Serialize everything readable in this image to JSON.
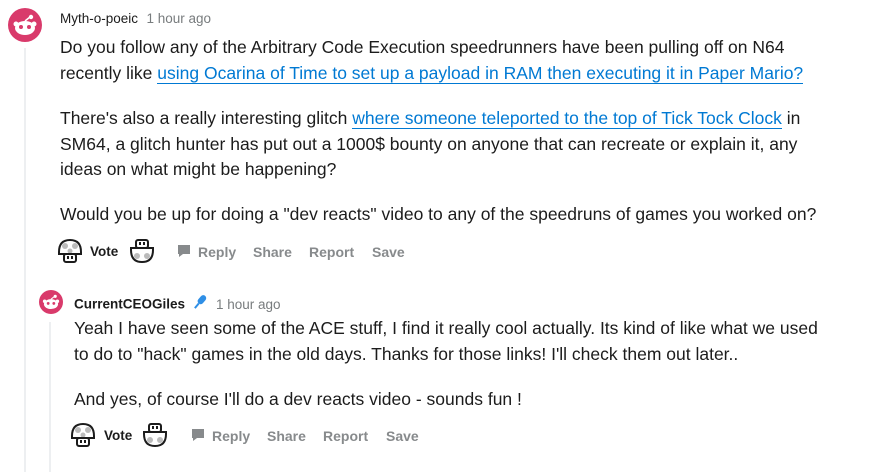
{
  "comment": {
    "author": "Myth-o-poeic",
    "time": "1 hour ago",
    "paragraphs": {
      "p1_line1": "Do you follow any of the Arbitrary Code Execution speedrunners have been pulling off on N64",
      "p1_line2_prefix": "recently like ",
      "p1_link": "using Ocarina of Time to set up a payload in RAM then executing it in Paper Mario?",
      "p2_line1_prefix": "There's also a really interesting glitch ",
      "p2_link": "where someone teleported to the top of Tick Tock Clock",
      "p2_line1_suffix": " in",
      "p2_line2": "SM64, a glitch hunter has put out a 1000$ bounty on anyone that can recreate or explain it, any",
      "p2_line3": "ideas on what might be happening?",
      "p3": "Would you be up for doing a \"dev reacts\" video to any of the speedruns of games you worked on?"
    },
    "actions": {
      "vote": "Vote",
      "reply": "Reply",
      "share": "Share",
      "report": "Report",
      "save": "Save"
    }
  },
  "reply": {
    "author": "CurrentCEOGiles",
    "time": "1 hour ago",
    "paragraphs": {
      "p1_line1": "Yeah I have seen some of the ACE stuff, I find it really cool actually. Its kind of like what we used",
      "p1_line2": "to do to \"hack\" games in the old days. Thanks for those links! I'll check them out later..",
      "p2": "And yes, of course I'll do a dev reacts video - sounds fun !"
    },
    "actions": {
      "vote": "Vote",
      "reply": "Reply",
      "share": "Share",
      "report": "Report",
      "save": "Save"
    }
  },
  "colors": {
    "link": "#0079d3",
    "meta": "#787c7e",
    "action": "#878a8c",
    "avatar": "#d93a6b",
    "mic_badge": "#2f8fe6"
  },
  "icons": [
    "snoo-avatar-icon",
    "upvote-mushroom-icon",
    "downvote-mushroom-icon",
    "comment-bubble-icon",
    "microphone-badge-icon"
  ]
}
